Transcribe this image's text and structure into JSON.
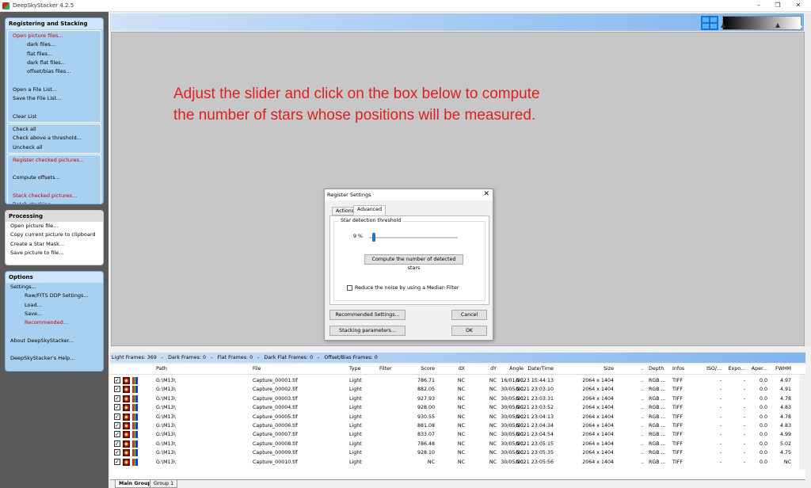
{
  "window": {
    "title": "DeepSkyStacker 4.2.5"
  },
  "sidebar": {
    "registering": {
      "header": "Registering and Stacking",
      "group1": [
        {
          "label": "Open picture files...",
          "red": true
        },
        {
          "label": "dark files...",
          "sub": true
        },
        {
          "label": "flat files...",
          "sub": true
        },
        {
          "label": "dark flat files...",
          "sub": true
        },
        {
          "label": "offset/bias files...",
          "sub": true
        },
        {
          "label": ""
        },
        {
          "label": "Open a File List..."
        },
        {
          "label": "Save the File List..."
        },
        {
          "label": ""
        },
        {
          "label": "Clear List"
        }
      ],
      "group2": [
        {
          "label": "Check all"
        },
        {
          "label": "Check above a threshold..."
        },
        {
          "label": "Uncheck all"
        }
      ],
      "group3": [
        {
          "label": "Register checked pictures...",
          "red": true
        },
        {
          "label": ""
        },
        {
          "label": "Compute offsets..."
        },
        {
          "label": ""
        },
        {
          "label": "Stack checked pictures...",
          "red": true
        },
        {
          "label": "Batch stacking..."
        }
      ]
    },
    "processing": {
      "header": "Processing",
      "items": [
        {
          "label": "Open picture file..."
        },
        {
          "label": "Copy current picture to clipboard"
        },
        {
          "label": "Create a Star Mask..."
        },
        {
          "label": "Save picture to file..."
        }
      ]
    },
    "options": {
      "header": "Options",
      "items": [
        {
          "label": "Settings..."
        },
        {
          "label": "Raw/FITS DDP Settings...",
          "sub": true
        },
        {
          "label": "Load...",
          "sub": true
        },
        {
          "label": "Save...",
          "sub": true
        },
        {
          "label": "Recommended...",
          "sub": true,
          "red": true
        },
        {
          "label": ""
        },
        {
          "label": "About DeepSkyStacker..."
        },
        {
          "label": ""
        },
        {
          "label": "DeepSkyStacker's Help..."
        }
      ]
    }
  },
  "instruction": {
    "line1": "Adjust the slider and click on the box below to compute",
    "line2": "the number of stars whose positions will be measured."
  },
  "dialog": {
    "title": "Register Settings",
    "tabs": [
      "Actions",
      "Advanced"
    ],
    "fieldset_label": "Star detection threshold",
    "threshold_label": "9 %",
    "threshold_value": 9,
    "compute_button": "Compute the number of detected stars",
    "median_filter_label": "Reduce the noise by using a Median Filter",
    "median_filter_checked": false,
    "recommended_button": "Recommended Settings...",
    "cancel_button": "Cancel",
    "stacking_button": "Stacking parameters...",
    "ok_button": "OK"
  },
  "infobar": {
    "light": "Light Frames: 369",
    "dark": "Dark Frames: 0",
    "flat": "Flat Frames: 0",
    "darkflat": "Dark Flat Frames: 0",
    "offset": "Offset/Bias Frames: 0",
    "sep": "-"
  },
  "table": {
    "columns": [
      "Path",
      "File",
      "Type",
      "Filter",
      "Score",
      "dX",
      "dY",
      "Angle",
      "Date/Time",
      "Size",
      "..",
      "Depth",
      "Infos",
      "ISO/...",
      "Expo...",
      "Aper...",
      "FWHM"
    ],
    "rows": [
      [
        "G:\\M13\\",
        "Capture_00001.tif",
        "Light",
        "",
        "786.71",
        "NC",
        "NC",
        "NC",
        "16/01/2023 15:44:13",
        "2064 x 1404",
        "..",
        "RGB ...",
        "TIFF",
        "-",
        "-",
        "0.0",
        "4.97"
      ],
      [
        "G:\\M13\\",
        "Capture_00002.tif",
        "Light",
        "",
        "882.05",
        "NC",
        "NC",
        "NC",
        "30/05/2021 23:03:10",
        "2064 x 1404",
        "..",
        "RGB ...",
        "TIFF",
        "-",
        "-",
        "0.0",
        "4.91"
      ],
      [
        "G:\\M13\\",
        "Capture_00003.tif",
        "Light",
        "",
        "927.93",
        "NC",
        "NC",
        "NC",
        "30/05/2021 23:03:31",
        "2064 x 1404",
        "..",
        "RGB ...",
        "TIFF",
        "-",
        "-",
        "0.0",
        "4.78"
      ],
      [
        "G:\\M13\\",
        "Capture_00004.tif",
        "Light",
        "",
        "928.00",
        "NC",
        "NC",
        "NC",
        "30/05/2021 23:03:52",
        "2064 x 1404",
        "..",
        "RGB ...",
        "TIFF",
        "-",
        "-",
        "0.0",
        "4.83"
      ],
      [
        "G:\\M13\\",
        "Capture_00005.tif",
        "Light",
        "",
        "930.55",
        "NC",
        "NC",
        "NC",
        "30/05/2021 23:04:13",
        "2064 x 1404",
        "..",
        "RGB ...",
        "TIFF",
        "-",
        "-",
        "0.0",
        "4.78"
      ],
      [
        "G:\\M13\\",
        "Capture_00006.tif",
        "Light",
        "",
        "881.08",
        "NC",
        "NC",
        "NC",
        "30/05/2021 23:04:34",
        "2064 x 1404",
        "..",
        "RGB ...",
        "TIFF",
        "-",
        "-",
        "0.0",
        "4.83"
      ],
      [
        "G:\\M13\\",
        "Capture_00007.tif",
        "Light",
        "",
        "833.07",
        "NC",
        "NC",
        "NC",
        "30/05/2021 23:04:54",
        "2064 x 1404",
        "..",
        "RGB ...",
        "TIFF",
        "-",
        "-",
        "0.0",
        "4.99"
      ],
      [
        "G:\\M13\\",
        "Capture_00008.tif",
        "Light",
        "",
        "786.48",
        "NC",
        "NC",
        "NC",
        "30/05/2021 23:05:15",
        "2064 x 1404",
        "..",
        "RGB ...",
        "TIFF",
        "-",
        "-",
        "0.0",
        "5.02"
      ],
      [
        "G:\\M13\\",
        "Capture_00009.tif",
        "Light",
        "",
        "928.10",
        "NC",
        "NC",
        "NC",
        "30/05/2021 23:05:35",
        "2064 x 1404",
        "..",
        "RGB ...",
        "TIFF",
        "-",
        "-",
        "0.0",
        "4.75"
      ],
      [
        "G:\\M13\\",
        "Capture_00010.tif",
        "Light",
        "",
        "NC",
        "NC",
        "NC",
        "NC",
        "30/05/2021 23:05:56",
        "2064 x 1404",
        "..",
        "RGB ...",
        "TIFF",
        "-",
        "-",
        "0.0",
        "NC"
      ]
    ]
  },
  "bottom_tabs": [
    "Main Group",
    "Group 1"
  ],
  "colors": {
    "accent": "#1a74d0",
    "instruction": "#e02020",
    "panel": "#a8d0f0"
  }
}
